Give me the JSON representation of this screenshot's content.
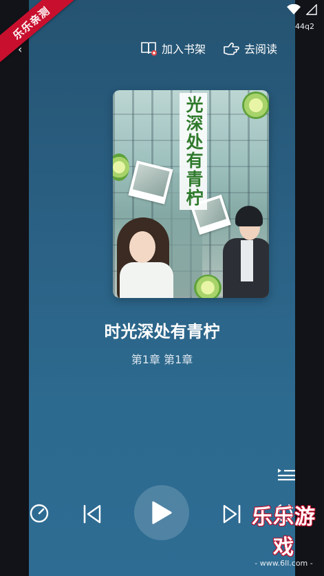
{
  "status": {
    "net_label": "44q2"
  },
  "ribbon": {
    "text": "乐乐亲测"
  },
  "header": {
    "add_shelf_label": "加入书架",
    "go_read_label": "去阅读"
  },
  "cover": {
    "title": "光深处有青柠"
  },
  "book": {
    "title": "时光深处有青柠",
    "chapter": "第1章  第1章"
  },
  "watermark": {
    "big": "乐乐游戏",
    "small": "- www.6ll.com -"
  },
  "colors": {
    "accent": "#c8102e",
    "background": "#2a5f82"
  }
}
